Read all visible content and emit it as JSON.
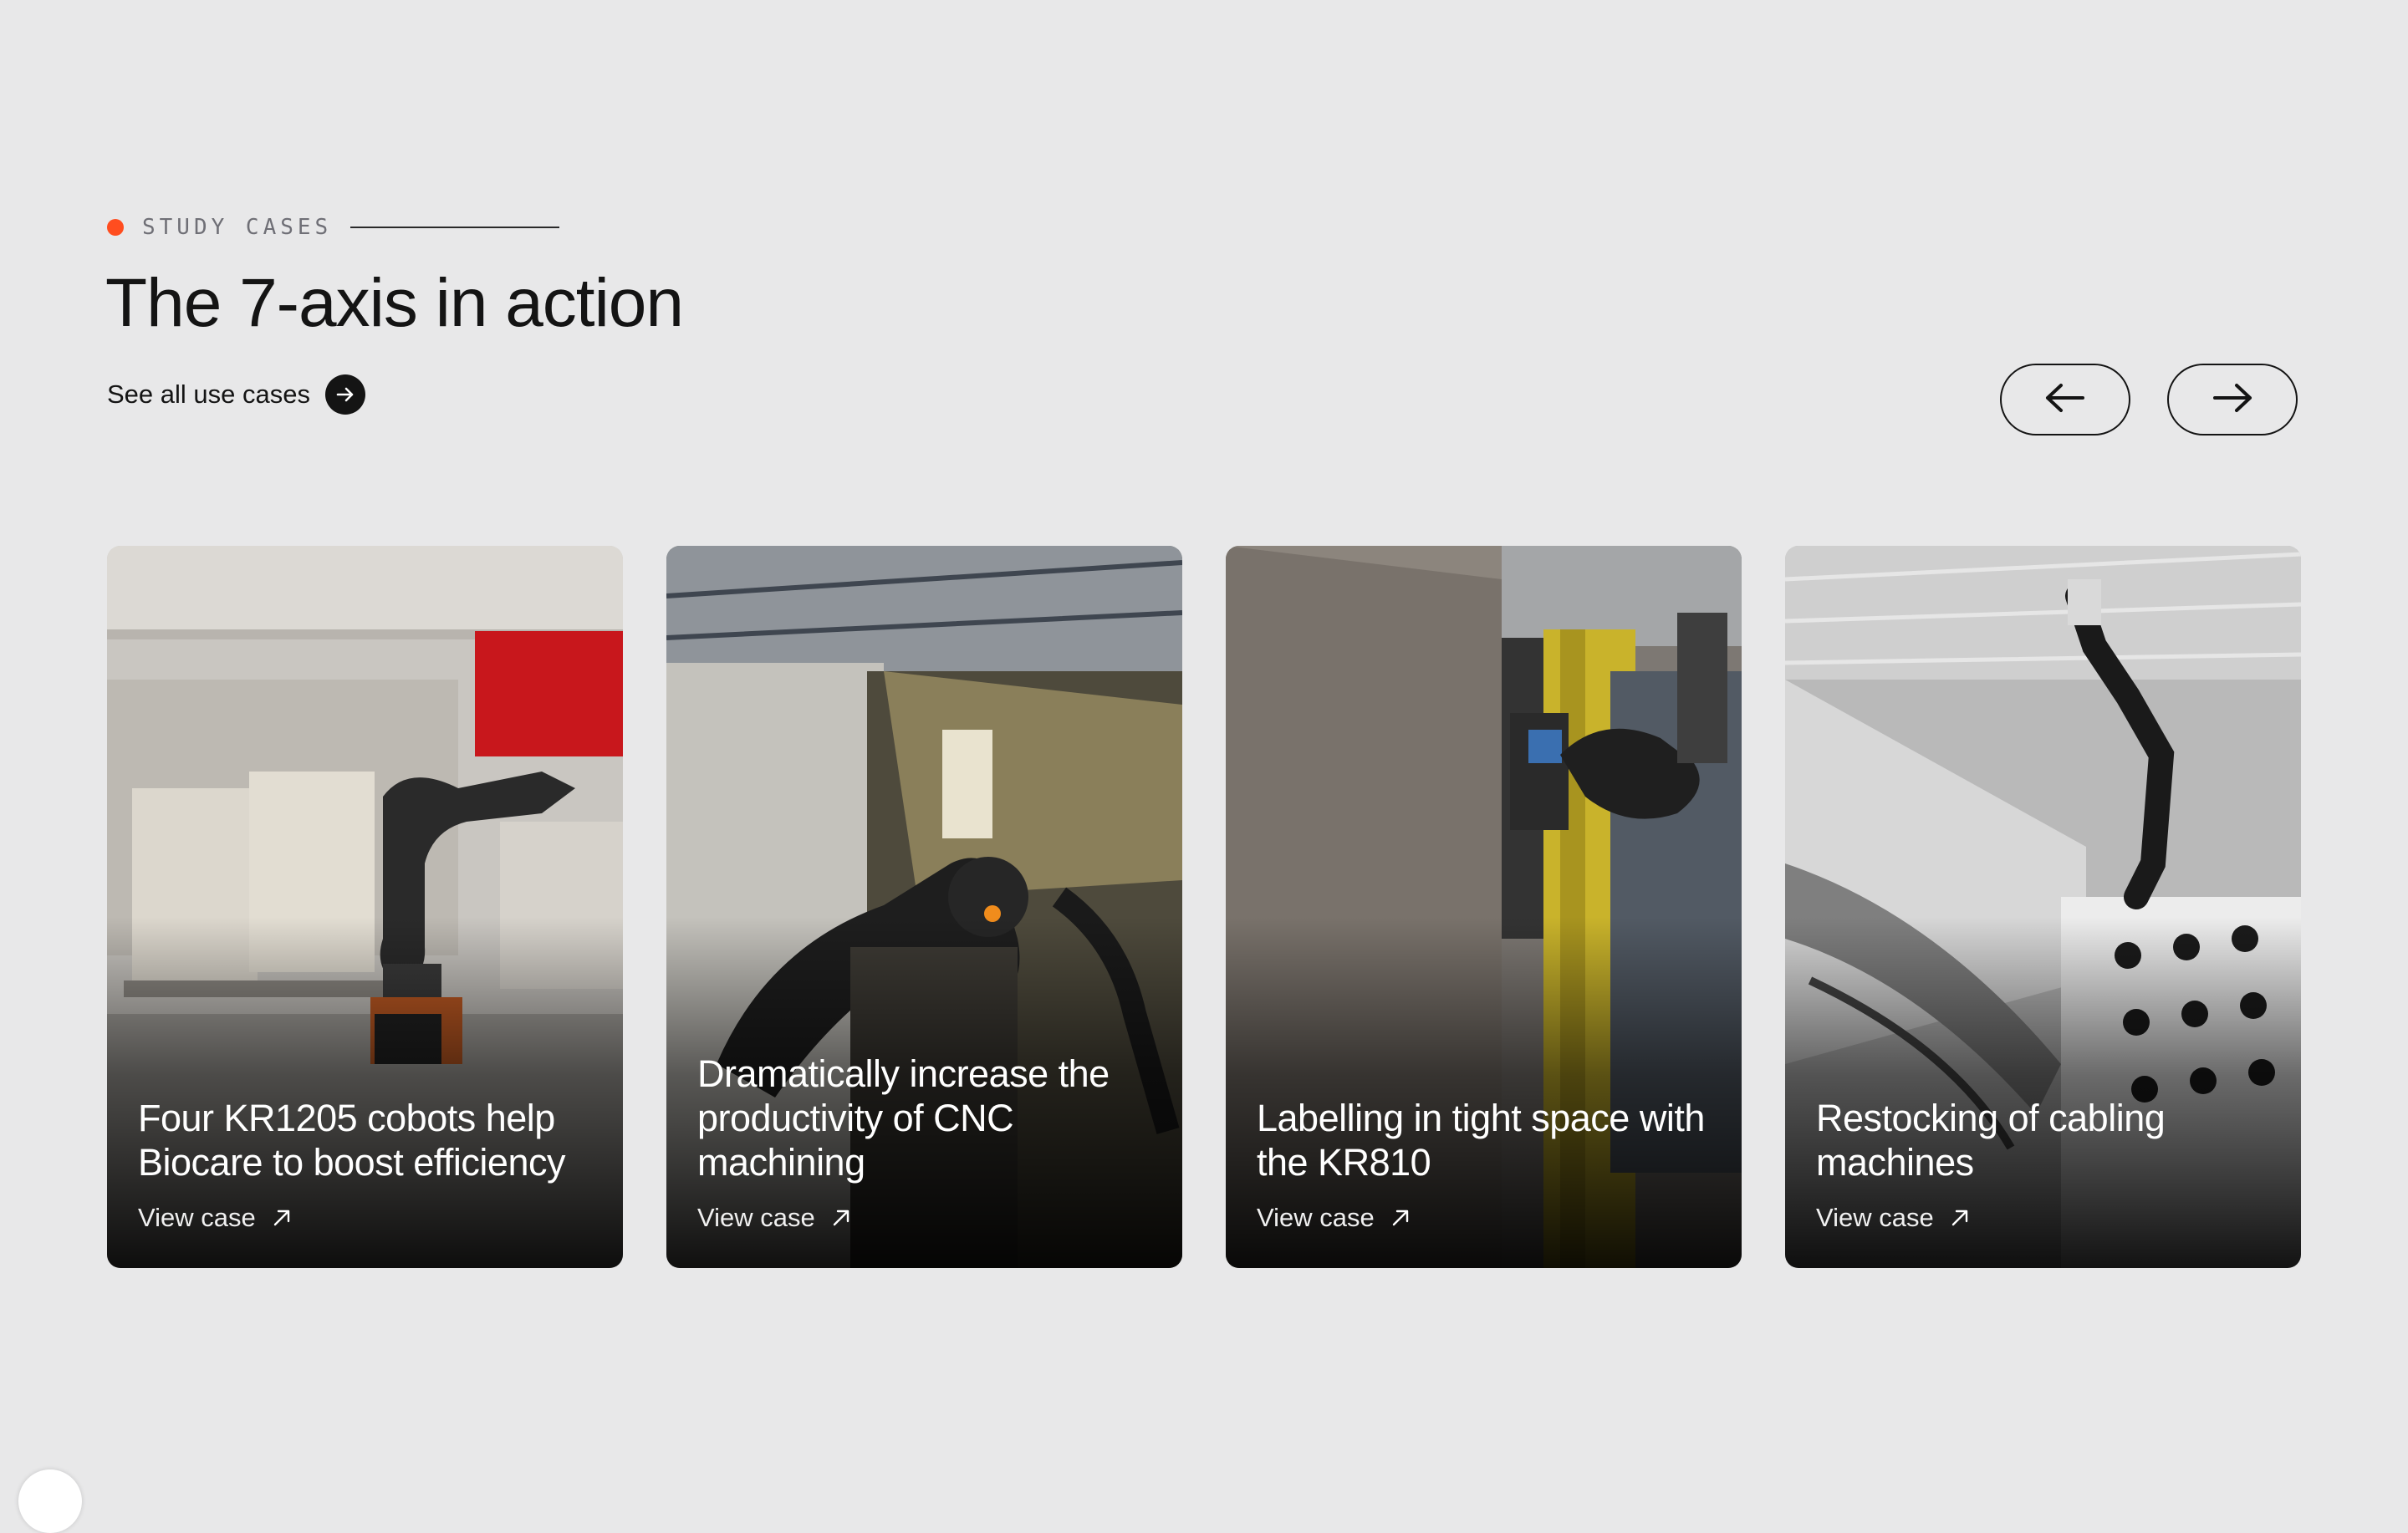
{
  "section": {
    "eyebrow": "STUDY CASES",
    "title": "The 7-axis in action",
    "see_all_label": "See all use cases"
  },
  "carousel": {
    "prev_icon": "arrow-left-icon",
    "next_icon": "arrow-right-icon"
  },
  "cards": [
    {
      "title": "Four KR1205 cobots help Biocare to boost efficiency",
      "link_label": "View case",
      "image": "robot-arm-lab-photo"
    },
    {
      "title": "Dramatically increase the productivity of CNC machining",
      "link_label": "View case",
      "image": "robot-arm-cnc-photo"
    },
    {
      "title": "Labelling in tight space with the KR810",
      "link_label": "View case",
      "image": "robot-arm-labelling-photo"
    },
    {
      "title": "Restocking of cabling machines",
      "link_label": "View case",
      "image": "robot-arm-cabling-photo"
    }
  ],
  "colors": {
    "background": "#e8e8e9",
    "accent": "#ff4d1f",
    "text": "#141414"
  }
}
